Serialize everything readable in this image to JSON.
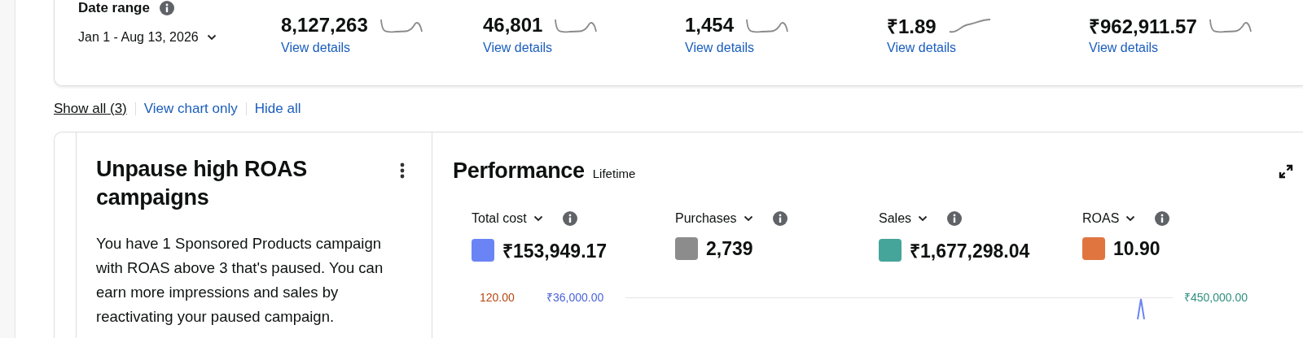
{
  "summary": {
    "date_range": {
      "label": "Date range",
      "value": "Jan 1 - Aug 13, 2026"
    },
    "metrics": [
      {
        "value": "8,127,263",
        "link": "View details"
      },
      {
        "value": "46,801",
        "link": "View details"
      },
      {
        "value": "1,454",
        "link": "View details"
      },
      {
        "value": "₹1.89",
        "link": "View details"
      },
      {
        "value": "₹962,911.57",
        "link": "View details"
      }
    ]
  },
  "view_links": [
    {
      "label": "Show all (3)",
      "selected": true
    },
    {
      "label": "View chart only",
      "selected": false
    },
    {
      "label": "Hide all",
      "selected": false
    }
  ],
  "recommendation": {
    "title": "Unpause high ROAS campaigns",
    "text": "You have 1 Sponsored Products campaign with ROAS above 3 that's paused. You can earn more impressions and sales by reactivating your paused campaign."
  },
  "performance": {
    "title": "Performance",
    "period": "Lifetime",
    "metrics": [
      {
        "label": "Total cost",
        "value": "₹153,949.17",
        "color": "#6b84f5"
      },
      {
        "label": "Purchases",
        "value": "2,739",
        "color": "#8c8c8c"
      },
      {
        "label": "Sales",
        "value": "₹1,677,298.04",
        "color": "#45a59a"
      },
      {
        "label": "ROAS",
        "value": "10.90",
        "color": "#e07540"
      }
    ],
    "axis_labels": {
      "left_outer": "120.00",
      "left_inner": "₹36,000.00",
      "right": "₹450,000.00"
    }
  }
}
